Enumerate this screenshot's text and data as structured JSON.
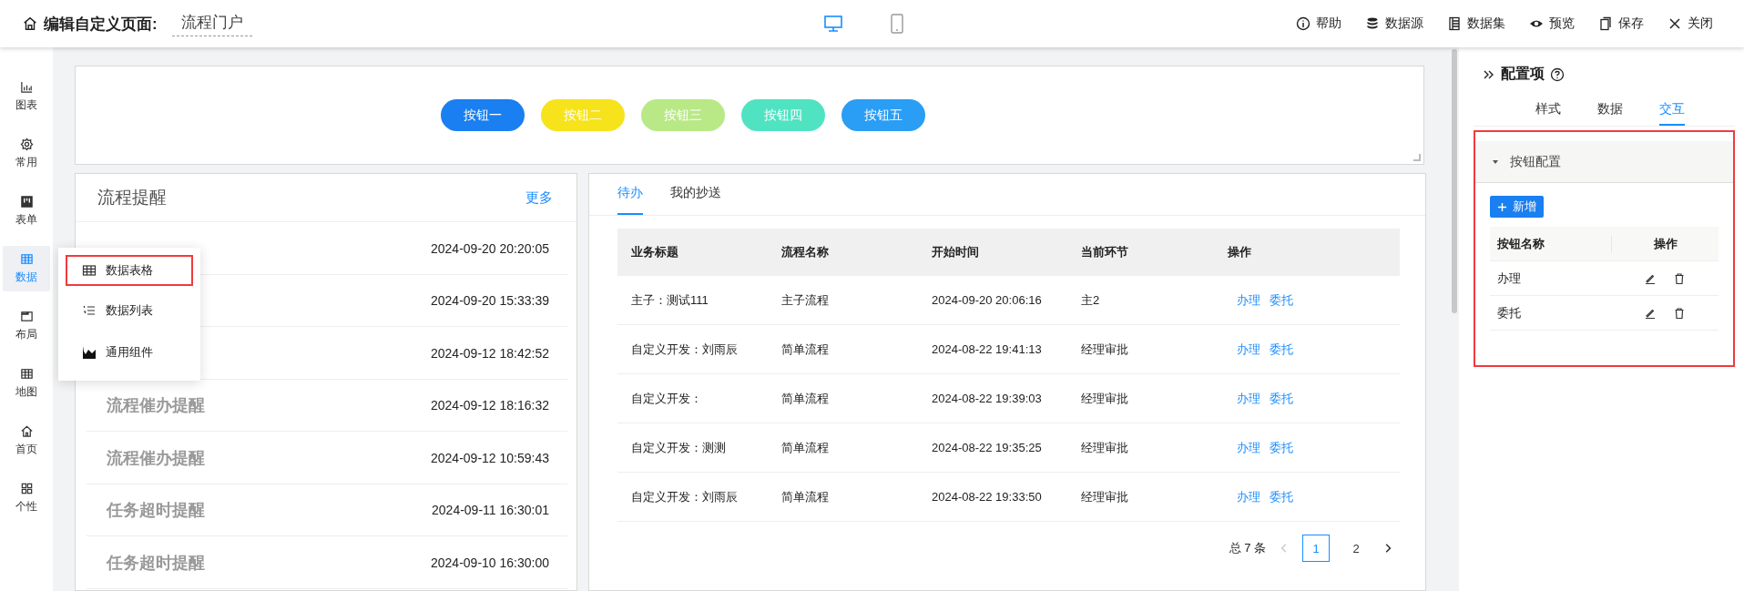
{
  "header": {
    "title": "编辑自定义页面:",
    "page_name": "流程门户",
    "devices": [
      {
        "kind": "desktop",
        "selected": true
      },
      {
        "kind": "mobile",
        "selected": false
      }
    ],
    "actions": [
      {
        "kind": "help",
        "label": "帮助"
      },
      {
        "kind": "datasource",
        "label": "数据源"
      },
      {
        "kind": "dataset",
        "label": "数据集"
      },
      {
        "kind": "preview",
        "label": "预览"
      },
      {
        "kind": "save",
        "label": "保存"
      },
      {
        "kind": "close",
        "label": "关闭"
      }
    ]
  },
  "sidebar": {
    "items": [
      {
        "kind": "chart",
        "label": "图表",
        "selected": false
      },
      {
        "kind": "common",
        "label": "常用",
        "selected": false
      },
      {
        "kind": "form",
        "label": "表单",
        "selected": false
      },
      {
        "kind": "data",
        "label": "数据",
        "selected": true
      },
      {
        "kind": "layout",
        "label": "布局",
        "selected": false
      },
      {
        "kind": "map",
        "label": "地图",
        "selected": false
      },
      {
        "kind": "home",
        "label": "首页",
        "selected": false
      },
      {
        "kind": "personal",
        "label": "个性",
        "selected": false
      }
    ]
  },
  "popup_menu": {
    "items": [
      {
        "kind": "table",
        "label": "数据表格",
        "highlighted": true
      },
      {
        "kind": "list",
        "label": "数据列表",
        "highlighted": false
      },
      {
        "kind": "area",
        "label": "通用组件",
        "highlighted": false
      }
    ]
  },
  "button_bar": {
    "buttons": [
      {
        "label": "按钮一",
        "color": "#1a7ff0"
      },
      {
        "label": "按钮二",
        "color": "#f6e31c"
      },
      {
        "label": "按钮三",
        "color": "#b8e986"
      },
      {
        "label": "按钮四",
        "color": "#50e3c2"
      },
      {
        "label": "按钮五",
        "color": "#2a9df4"
      }
    ]
  },
  "reminders": {
    "title": "流程提醒",
    "more": "更多",
    "rows": [
      {
        "time": "2024-09-20 20:20:05"
      },
      {
        "time": "2024-09-20 15:33:39"
      },
      {
        "time": "2024-09-12 18:42:52"
      },
      {
        "title": "流程催办提醒",
        "time": "2024-09-12 18:16:32"
      },
      {
        "title": "流程催办提醒",
        "time": "2024-09-12 10:59:43"
      },
      {
        "title": "任务超时提醒",
        "time": "2024-09-11 16:30:01"
      },
      {
        "title": "任务超时提醒",
        "time": "2024-09-10 16:30:00"
      }
    ]
  },
  "tasks": {
    "tabs": [
      {
        "label": "待办",
        "selected": true
      },
      {
        "label": "我的抄送",
        "selected": false
      }
    ],
    "columns": [
      "业务标题",
      "流程名称",
      "开始时间",
      "当前环节",
      "操作"
    ],
    "rows": [
      {
        "cells": [
          "主子：测试111",
          "主子流程",
          "2024-09-20 20:06:16",
          "主2"
        ],
        "actions": [
          "办理",
          "委托"
        ]
      },
      {
        "cells": [
          "自定义开发：刘雨辰",
          "简单流程",
          "2024-08-22 19:41:13",
          "经理审批"
        ],
        "actions": [
          "办理",
          "委托"
        ]
      },
      {
        "cells": [
          "自定义开发：",
          "简单流程",
          "2024-08-22 19:39:03",
          "经理审批"
        ],
        "actions": [
          "办理",
          "委托"
        ]
      },
      {
        "cells": [
          "自定义开发：测测",
          "简单流程",
          "2024-08-22 19:35:25",
          "经理审批"
        ],
        "actions": [
          "办理",
          "委托"
        ]
      },
      {
        "cells": [
          "自定义开发：刘雨辰",
          "简单流程",
          "2024-08-22 19:33:50",
          "经理审批"
        ],
        "actions": [
          "办理",
          "委托"
        ]
      }
    ],
    "pagination": {
      "total": "总 7 条",
      "pages": [
        {
          "label": "1",
          "selected": true
        },
        {
          "label": "2",
          "selected": false
        }
      ]
    }
  },
  "config": {
    "title": "配置项",
    "tabs": [
      {
        "label": "样式",
        "selected": false
      },
      {
        "label": "数据",
        "selected": false
      },
      {
        "label": "交互",
        "selected": true
      }
    ],
    "section": {
      "title": "按钮配置",
      "expanded": true,
      "highlighted": true,
      "add_label": "新增",
      "columns": [
        "按钮名称",
        "操作"
      ],
      "rows": [
        "办理",
        "委托"
      ]
    }
  }
}
